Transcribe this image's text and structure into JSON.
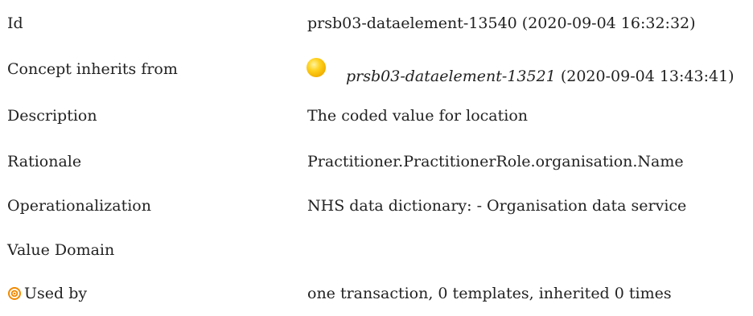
{
  "rows": {
    "id": {
      "label": "Id",
      "value": "prsb03-dataelement-13540 (2020-09-04 16:32:32)"
    },
    "inherits": {
      "label": "Concept inherits from",
      "link": "prsb03-dataelement-13521",
      "date": "(2020-09-04 13:43:41)",
      "icon": "yellow-circle-icon",
      "icon_color": "#ffd21f"
    },
    "description": {
      "label": "Description",
      "value": "The coded value for location"
    },
    "rationale": {
      "label": "Rationale",
      "value": "Practitioner.PractitionerRole.organisation.Name"
    },
    "operationalization": {
      "label": "Operationalization",
      "value": "NHS data dictionary: - Organisation data service"
    },
    "valuedomain": {
      "label": "Value Domain",
      "value": ""
    },
    "usedby": {
      "label": "Used by",
      "value": "one transaction, 0 templates, inherited 0 times",
      "icon": "target-icon",
      "icon_color": "#f08a00"
    }
  }
}
